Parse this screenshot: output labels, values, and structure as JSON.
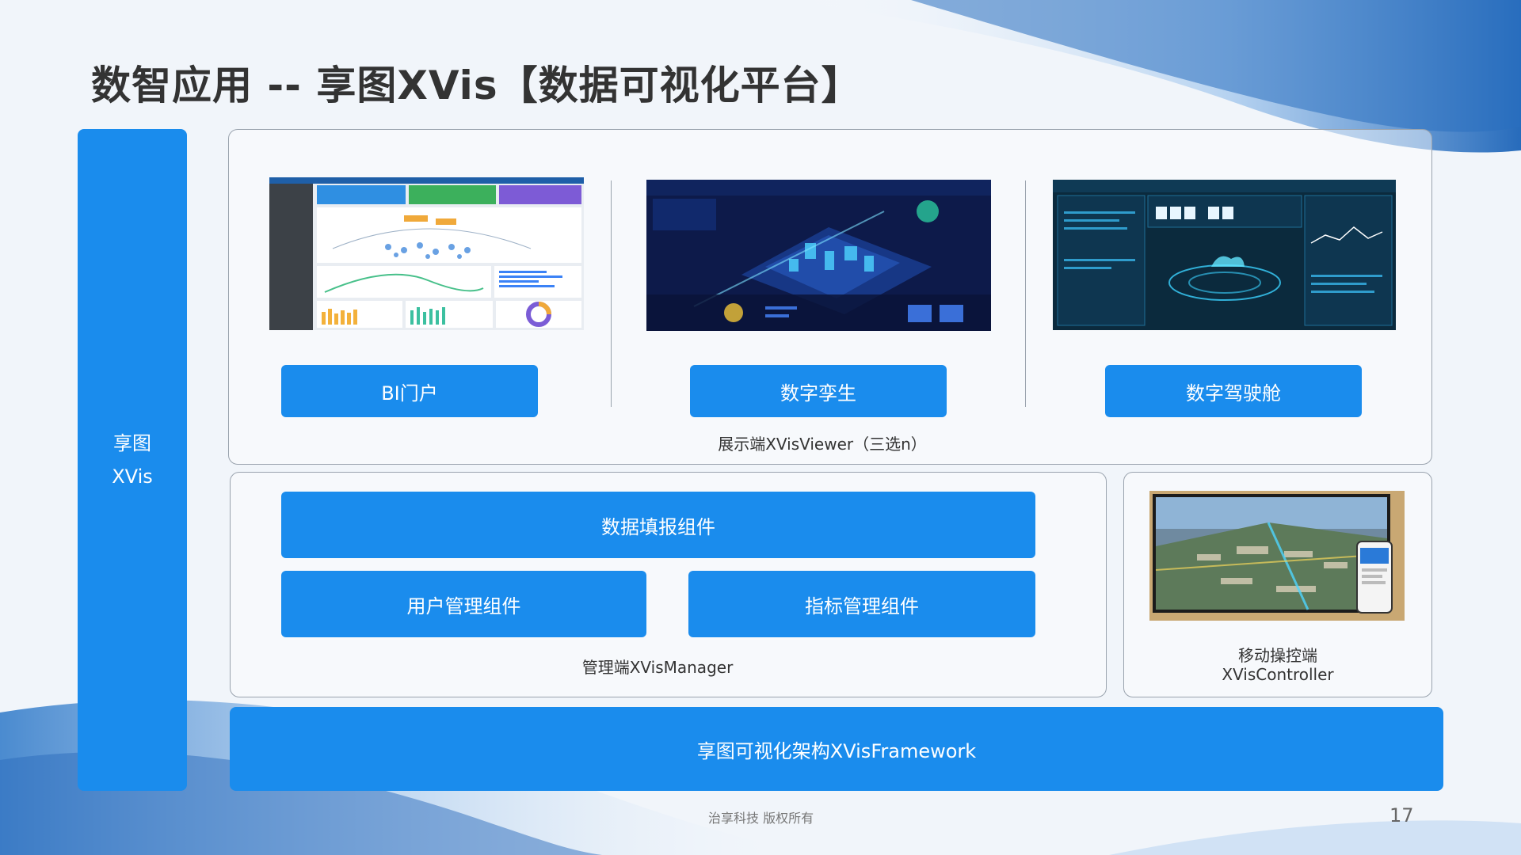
{
  "slide": {
    "title": "数智应用 -- 享图XVis【数据可视化平台】"
  },
  "left_bar": {
    "line1": "享图",
    "line2": "XVis"
  },
  "viewer": {
    "items": [
      {
        "label": "BI门户"
      },
      {
        "label": "数字孪生"
      },
      {
        "label": "数字驾驶舱"
      }
    ],
    "caption": "展示端XVisViewer（三选n）"
  },
  "manager": {
    "fill_component": "数据填报组件",
    "user_component": "用户管理组件",
    "indicator_component": "指标管理组件",
    "caption": "管理端XVisManager"
  },
  "controller": {
    "caption_line1": "移动操控端",
    "caption_line2": "XVisController"
  },
  "framework": {
    "label": "享图可视化架构XVisFramework"
  },
  "footer": {
    "copyright": "治享科技 版权所有",
    "page_number": "17"
  },
  "colors": {
    "accent": "#1a8ced",
    "border": "#9aa3ae",
    "title": "#333333"
  }
}
